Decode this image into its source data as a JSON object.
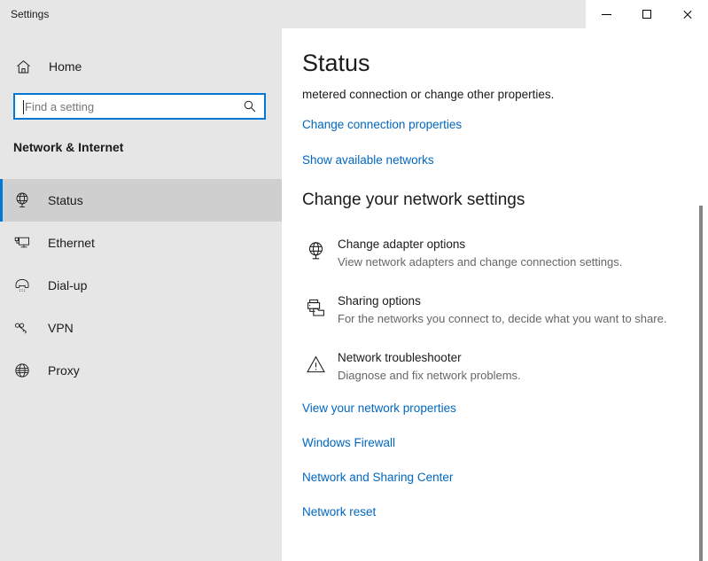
{
  "window": {
    "title": "Settings",
    "controls": {
      "minimize": "minimize-button",
      "maximize": "maximize-button",
      "close": "close-button"
    }
  },
  "colors": {
    "accent": "#0078d7",
    "link": "#0067c0",
    "sidebar_bg": "#e6e6e6",
    "selected_bg": "#cfcfcf",
    "content_bg": "#ffffff",
    "text": "#1b1b1b",
    "muted_text": "#666666",
    "scrollbar_thumb": "#868686"
  },
  "sidebar": {
    "home": {
      "label": "Home",
      "icon": "home-icon"
    },
    "search": {
      "value": "",
      "placeholder": "Find a setting",
      "icon": "search-icon"
    },
    "section_title": "Network & Internet",
    "items": [
      {
        "label": "Status",
        "icon": "network-status-icon",
        "selected": true
      },
      {
        "label": "Ethernet",
        "icon": "ethernet-icon",
        "selected": false
      },
      {
        "label": "Dial-up",
        "icon": "dial-up-icon",
        "selected": false
      },
      {
        "label": "VPN",
        "icon": "vpn-key-icon",
        "selected": false
      },
      {
        "label": "Proxy",
        "icon": "globe-icon",
        "selected": false
      }
    ]
  },
  "main": {
    "page_title": "Status",
    "intro_text": "metered connection or change other properties.",
    "top_links": [
      {
        "label": "Change connection properties"
      },
      {
        "label": "Show available networks"
      }
    ],
    "subheading": "Change your network settings",
    "options": [
      {
        "title": "Change adapter options",
        "description": "View network adapters and change connection settings.",
        "icon": "network-adapter-icon"
      },
      {
        "title": "Sharing options",
        "description": "For the networks you connect to, decide what you want to share.",
        "icon": "sharing-printer-folder-icon"
      },
      {
        "title": "Network troubleshooter",
        "description": "Diagnose and fix network problems.",
        "icon": "warning-triangle-icon"
      }
    ],
    "bottom_links": [
      {
        "label": "View your network properties"
      },
      {
        "label": "Windows Firewall"
      },
      {
        "label": "Network and Sharing Center"
      },
      {
        "label": "Network reset"
      }
    ]
  }
}
